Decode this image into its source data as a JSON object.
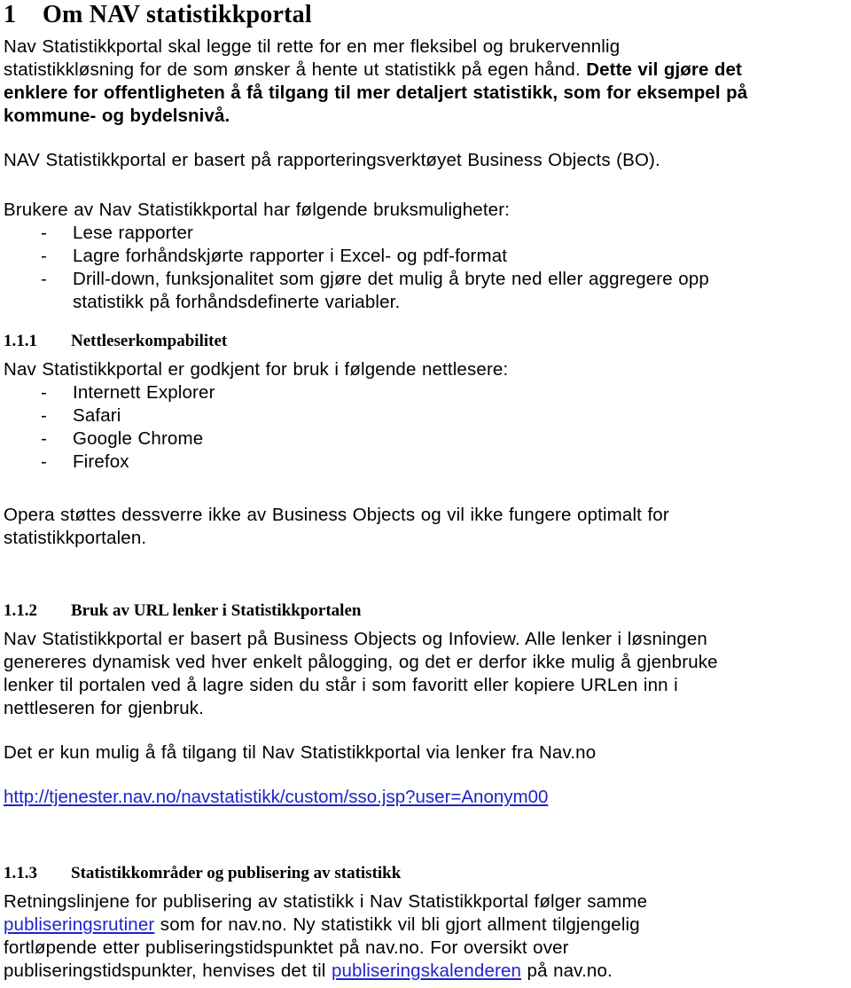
{
  "document": {
    "heading1": {
      "number": "1",
      "title": "Om NAV statistikkportal"
    },
    "intro": {
      "line1": "Nav Statistikkportal skal legge til rette for en mer fleksibel og brukervennlig",
      "line2": "statistikkløsning for de som ønsker å hente ut statistikk på egen hånd. ",
      "bold_tail_line2": "Dette vil gjøre det",
      "bold_line3": "enklere for offentligheten å få tilgang til mer detaljert statistikk, som for eksempel på",
      "bold_line4": "kommune- og bydelsnivå."
    },
    "basis_paragraph": "NAV Statistikkportal er basert på rapporteringsverktøyet Business Objects (BO).",
    "usage": {
      "intro": "Brukere av Nav Statistikkportal har følgende bruksmuligheter:",
      "bullet_marker": "-",
      "items": [
        "Lese rapporter",
        "Lagre forhåndskjørte rapporter i Excel- og pdf-format",
        "Drill-down, funksjonalitet som gjøre det mulig å bryte ned eller aggregere opp"
      ],
      "item3_continuation": "statistikk på forhåndsdefinerte variabler."
    },
    "section_111": {
      "number": "1.1.1",
      "title": "Nettleserkompabilitet",
      "intro": "Nav Statistikkportal er godkjent for bruk i følgende nettlesere:",
      "bullet_marker": "-",
      "browsers": [
        "Internett Explorer",
        "Safari",
        "Google Chrome",
        "Firefox"
      ],
      "opera_line1": "Opera støttes dessverre ikke av Business Objects og vil ikke fungere optimalt for",
      "opera_line2": "statistikkportalen."
    },
    "section_112": {
      "number": "1.1.2",
      "title": "Bruk av URL lenker i Statistikkportalen",
      "line1": "Nav Statistikkportal er basert på Business Objects og Infoview. Alle lenker i løsningen",
      "line2": "genereres dynamisk ved hver enkelt pålogging, og det er derfor ikke mulig å gjenbruke",
      "line3": "lenker til portalen ved å lagre siden du står i som favoritt eller kopiere URLen inn i",
      "line4": "nettleseren for gjenbruk.",
      "access_note": "Det er kun mulig å få tilgang til Nav Statistikkportal via lenker fra Nav.no",
      "url": "http://tjenester.nav.no/navstatistikk/custom/sso.jsp?user=Anonym00"
    },
    "section_113": {
      "number": "1.1.3",
      "title": "Statistikkområder og publisering av statistikk",
      "line1": "Retningslinjene for publisering av statistikk i Nav Statistikkportal følger samme",
      "link1": "publiseringsrutiner",
      "line2_after_link": " som for nav.no. Ny statistikk vil bli gjort allment tilgjengelig",
      "line3": "fortløpende etter publiseringstidspunktet på nav.no. For oversikt over",
      "line4_before_link": "publiseringstidspunkter, henvises det til ",
      "link2": "publiseringskalenderen",
      "line4_after_link": " på nav.no."
    },
    "colors": {
      "link": "#2222cc",
      "text": "#000000",
      "background": "#ffffff"
    }
  }
}
